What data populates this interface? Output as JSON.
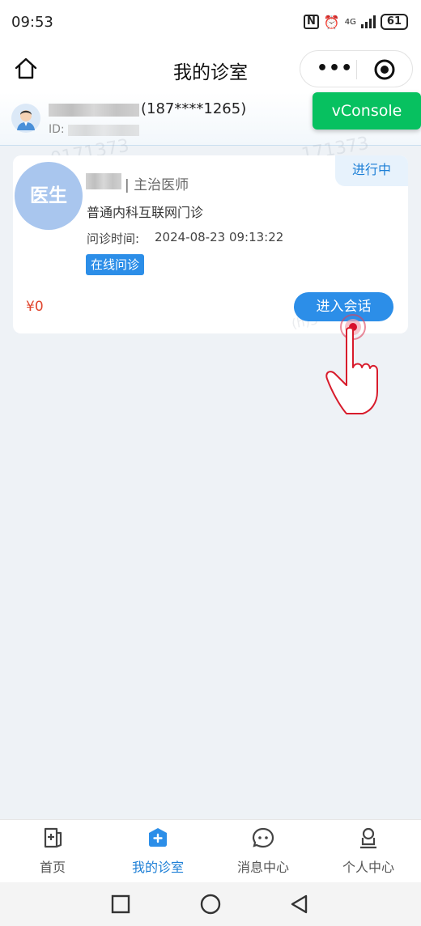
{
  "status_bar": {
    "time": "09:53",
    "network": "4G",
    "battery": "61"
  },
  "header": {
    "title": "我的诊室",
    "more_label": "•••"
  },
  "user": {
    "phone_masked": "(187****1265)",
    "id_label": "ID:"
  },
  "vconsole": {
    "label": "vConsole"
  },
  "card": {
    "status": "进行中",
    "doctor_avatar_text": "医生",
    "doctor_title": "| 主治医师",
    "department": "普通内科互联网门诊",
    "visit_time_label": "问诊时间:",
    "visit_time_value": "2024-08-23 09:13:22",
    "consult_type": "在线问诊",
    "price": "¥0",
    "enter_button": "进入会话"
  },
  "watermark_fragments": [
    "0171373",
    "171373",
    "(h)5"
  ],
  "tabbar": {
    "active_index": 1,
    "items": [
      {
        "label": "首页",
        "icon": "home-cross-icon"
      },
      {
        "label": "我的诊室",
        "icon": "clinic-plus-icon"
      },
      {
        "label": "消息中心",
        "icon": "message-bubble-icon"
      },
      {
        "label": "个人中心",
        "icon": "person-icon"
      }
    ]
  },
  "colors": {
    "accent": "#2c8ee8",
    "active_tab": "#1d7fd6",
    "price": "#e0452d",
    "vconsole": "#07c160",
    "background": "#eef2f6"
  }
}
